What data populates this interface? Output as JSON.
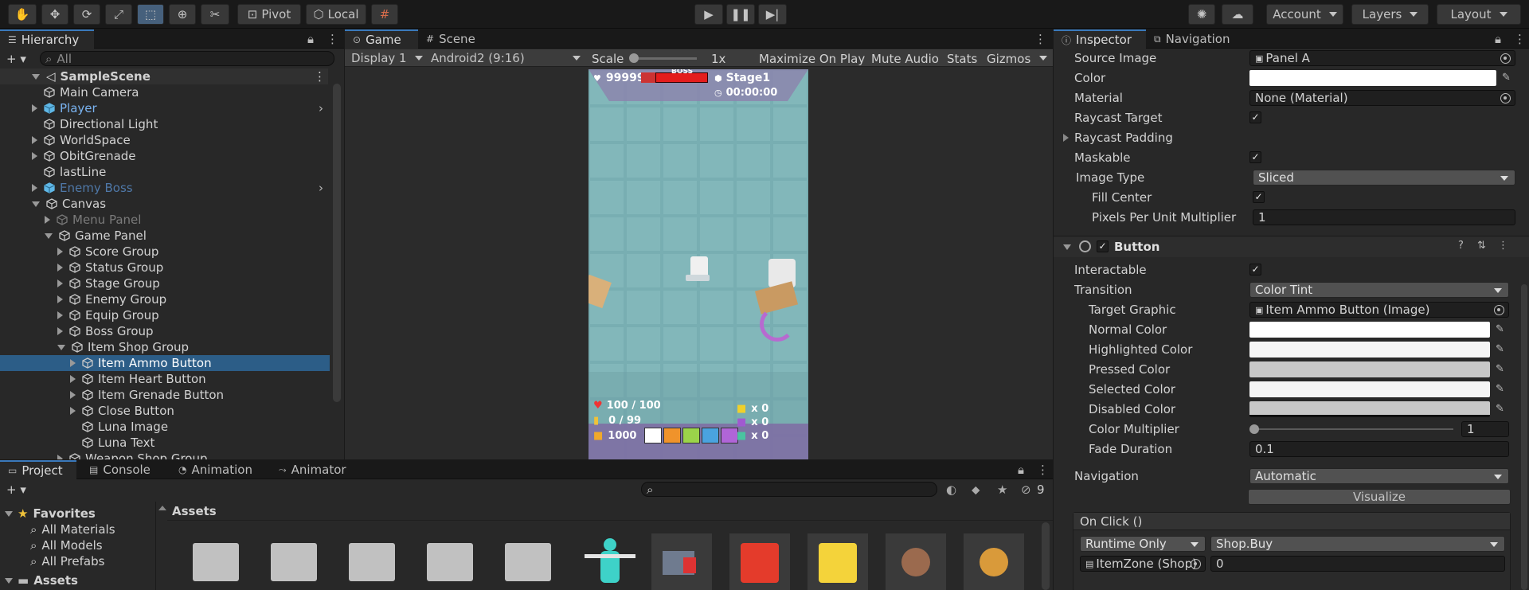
{
  "toolbar": {
    "pivot_label": "Pivot",
    "local_label": "Local",
    "account_label": "Account",
    "layers_label": "Layers",
    "layout_label": "Layout"
  },
  "hierarchy": {
    "tab_label": "Hierarchy",
    "search_placeholder": "All",
    "scene_name": "SampleScene",
    "items": [
      {
        "label": "Main Camera"
      },
      {
        "label": "Player"
      },
      {
        "label": "Directional Light"
      },
      {
        "label": "WorldSpace"
      },
      {
        "label": "ObitGrenade"
      },
      {
        "label": "lastLine"
      },
      {
        "label": "Enemy Boss"
      },
      {
        "label": "Canvas"
      },
      {
        "label": "Menu Panel"
      },
      {
        "label": "Game Panel"
      },
      {
        "label": "Score Group"
      },
      {
        "label": "Status Group"
      },
      {
        "label": "Stage Group"
      },
      {
        "label": "Enemy Group"
      },
      {
        "label": "Equip Group"
      },
      {
        "label": "Boss Group"
      },
      {
        "label": "Item Shop Group"
      },
      {
        "label": "Item Ammo Button"
      },
      {
        "label": "Item Heart Button"
      },
      {
        "label": "Item Grenade Button"
      },
      {
        "label": "Close Button"
      },
      {
        "label": "Luna Image"
      },
      {
        "label": "Luna Text"
      },
      {
        "label": "Weapon Shop Group"
      }
    ]
  },
  "game_view": {
    "tab_game": "Game",
    "tab_scene": "Scene",
    "display": "Display 1",
    "resolution": "Android2 (9:16)",
    "scale_label": "Scale",
    "scale_value": "1x",
    "maximize_label": "Maximize On Play",
    "mute_label": "Mute Audio",
    "stats_label": "Stats",
    "gizmos_label": "Gizmos",
    "hud": {
      "score": "99999",
      "boss_label": "BOSS",
      "stage": "Stage1",
      "timer": "00:00:00",
      "health": "100 / 100",
      "ammo": "0 / 99",
      "coins": "1000",
      "enemy_counts": [
        "x 0",
        "x 0",
        "x 0"
      ]
    }
  },
  "inspector": {
    "tab_inspector": "Inspector",
    "tab_navigation": "Navigation",
    "image_rows": {
      "source_image_label": "Source Image",
      "source_image_value": "Panel A",
      "color_label": "Color",
      "material_label": "Material",
      "material_value": "None (Material)",
      "raycast_target_label": "Raycast Target",
      "raycast_padding_label": "Raycast Padding",
      "maskable_label": "Maskable",
      "image_type_label": "Image Type",
      "image_type_value": "Sliced",
      "fill_center_label": "Fill Center",
      "ppu_label": "Pixels Per Unit Multiplier",
      "ppu_value": "1"
    },
    "button_component": {
      "title": "Button",
      "interactable_label": "Interactable",
      "transition_label": "Transition",
      "transition_value": "Color Tint",
      "target_graphic_label": "Target Graphic",
      "target_graphic_value": "Item Ammo Button (Image)",
      "normal_color_label": "Normal Color",
      "highlighted_color_label": "Highlighted Color",
      "pressed_color_label": "Pressed Color",
      "selected_color_label": "Selected Color",
      "disabled_color_label": "Disabled Color",
      "color_multiplier_label": "Color Multiplier",
      "color_multiplier_value": "1",
      "fade_duration_label": "Fade Duration",
      "fade_duration_value": "0.1",
      "navigation_label": "Navigation",
      "navigation_value": "Automatic",
      "visualize_label": "Visualize",
      "on_click_label": "On Click ()",
      "runtime_value": "Runtime Only",
      "function_value": "Shop.Buy",
      "object_value": "ItemZone (Shop)",
      "arg_value": "0"
    }
  },
  "project": {
    "tab_project": "Project",
    "tab_console": "Console",
    "tab_animation": "Animation",
    "tab_animator": "Animator",
    "favorites_label": "Favorites",
    "favorites": [
      "All Materials",
      "All Models",
      "All Prefabs"
    ],
    "assets_tree_label": "Assets",
    "assets_header": "Assets",
    "hidden_count": "9"
  }
}
